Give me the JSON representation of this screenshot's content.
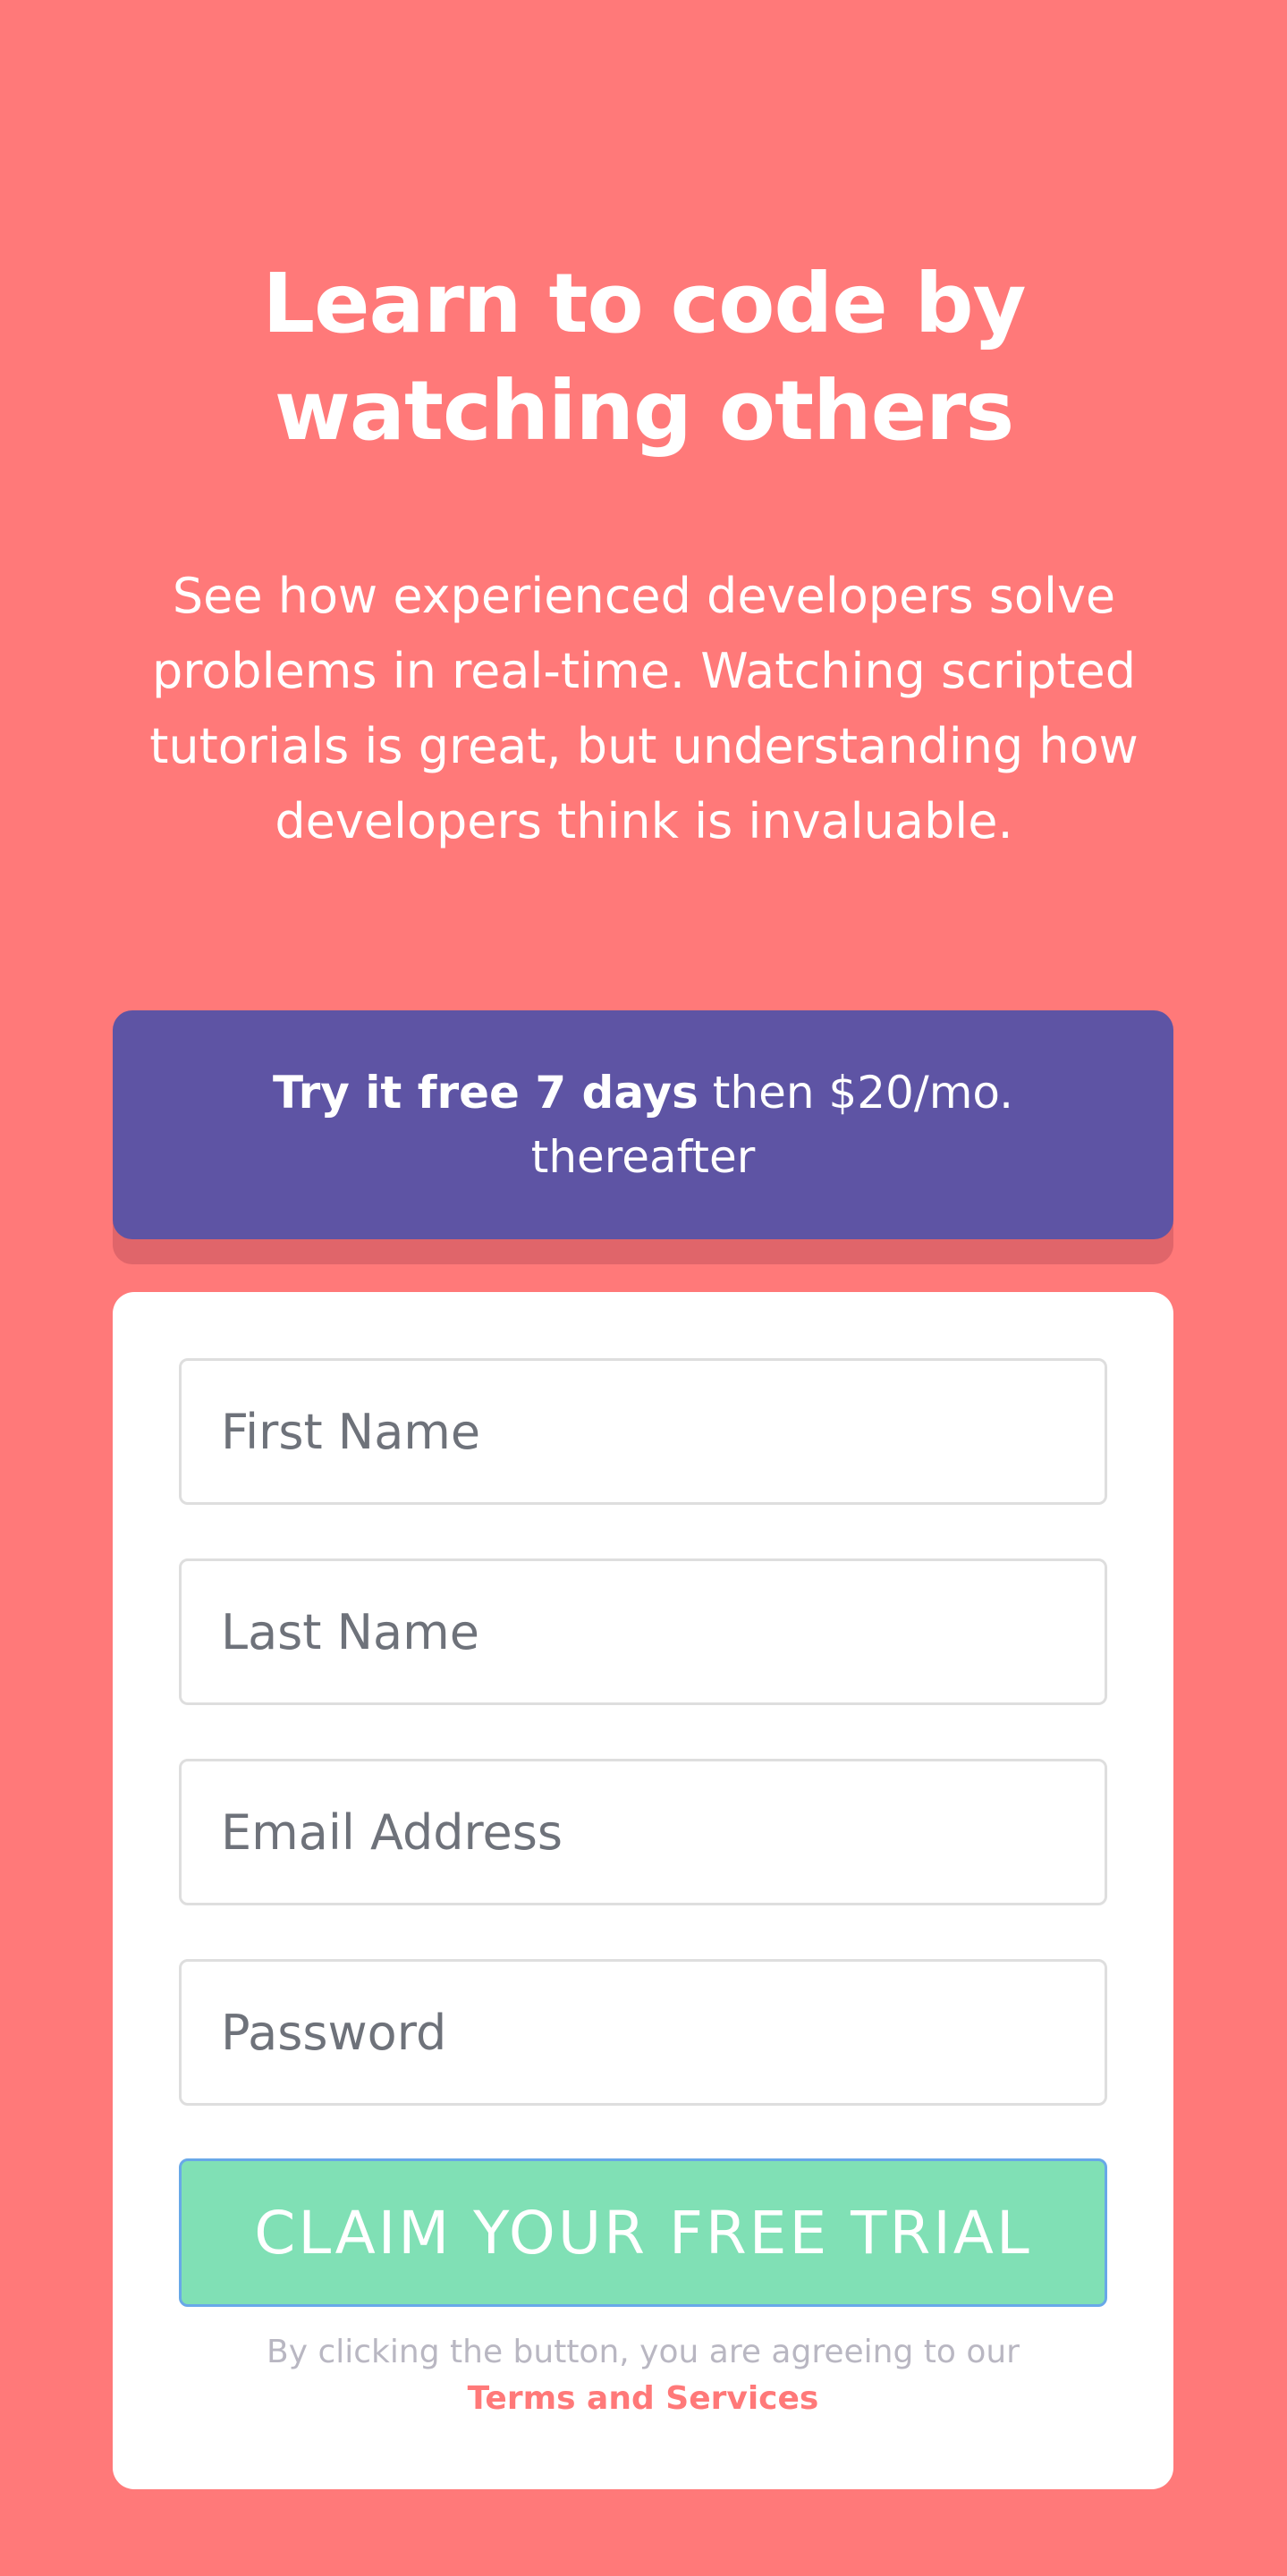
{
  "hero": {
    "title": "Learn to code by watching others",
    "description": "See how experienced developers solve problems in real-time. Watching scripted tutorials is great, but understanding how developers think is invaluable."
  },
  "promo": {
    "bold_text": "Try it free 7 days",
    "rest_text": "then $20/mo.",
    "second_line": "thereafter"
  },
  "form": {
    "first_name_placeholder": "First Name",
    "last_name_placeholder": "Last Name",
    "email_placeholder": "Email Address",
    "password_placeholder": "Password",
    "submit_label": "CLAIM YOUR FREE TRIAL",
    "terms_text": "By clicking the button, you are agreeing to our",
    "terms_link": "Terms and Services"
  },
  "colors": {
    "background": "#ff7979",
    "promo": "#5e54a4",
    "button": "#80e0b5",
    "link": "#ff7979"
  }
}
